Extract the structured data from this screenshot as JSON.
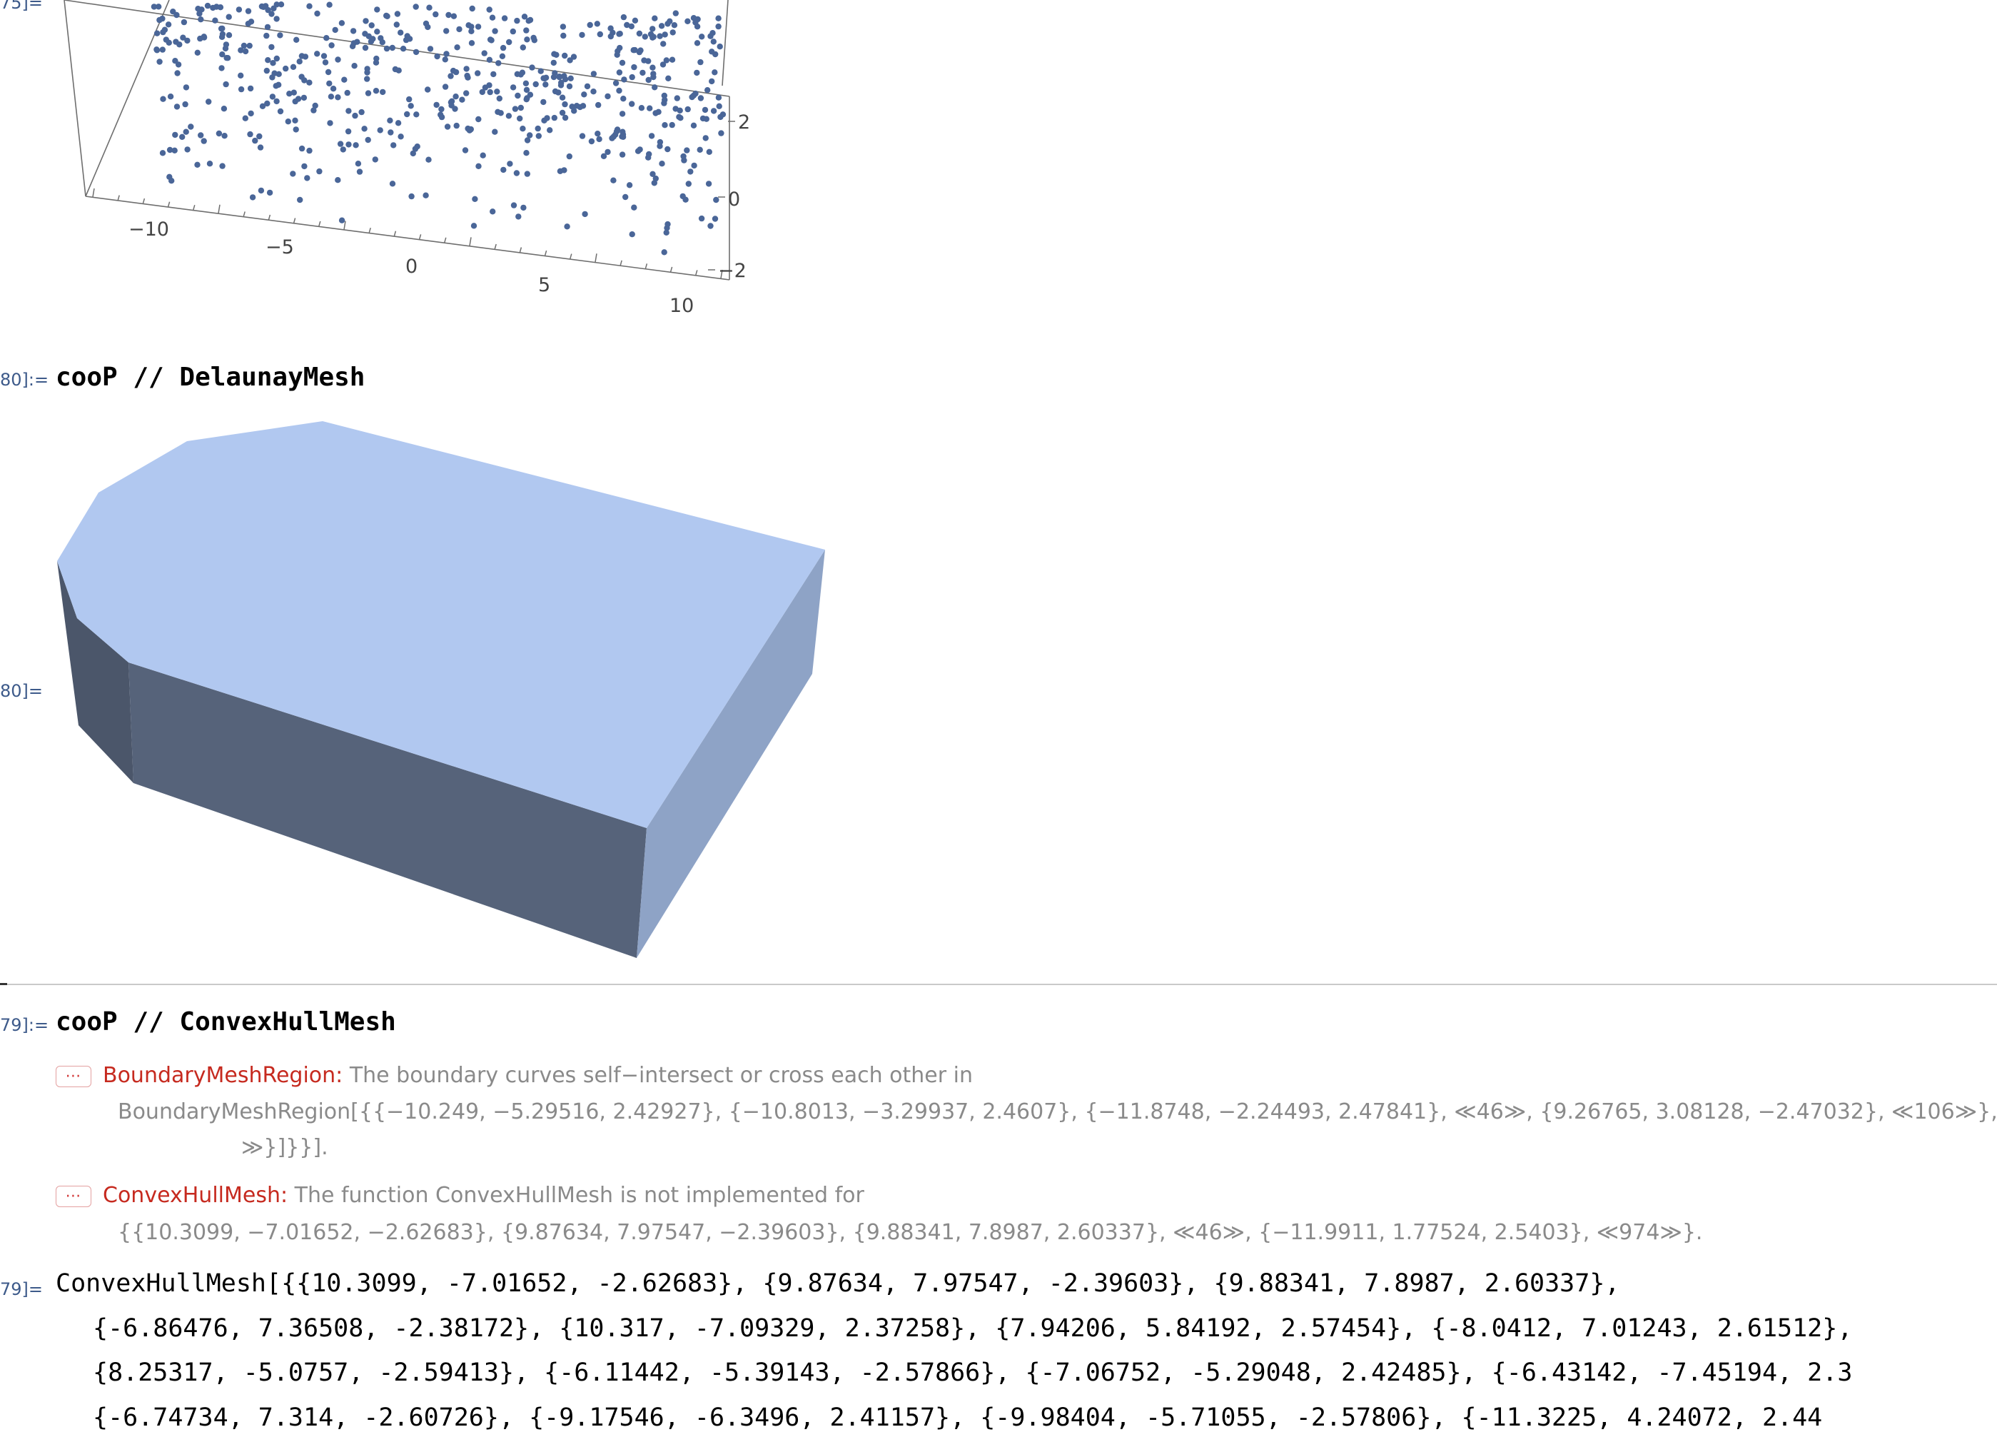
{
  "cells": {
    "out75_label": "75]=",
    "in80_label": "80]:=",
    "in80_code": "cooP // DelaunayMesh",
    "out80_label": "80]=",
    "in79_label": "79]:=",
    "in79_code": "cooP // ConvexHullMesh",
    "out79_label": "79]="
  },
  "scatter_plot": {
    "x_ticks": [
      "−10",
      "−5",
      "0",
      "5",
      "10"
    ],
    "z_ticks": [
      "2",
      "0",
      "−2"
    ],
    "point_color": "#4a6698"
  },
  "mesh": {
    "top_color": "#b1c8f0",
    "front_color": "#56637a",
    "right_color": "#8ea3c6",
    "left_color": "#4a5568"
  },
  "messages": [
    {
      "fn": "BoundaryMeshRegion",
      "colon": ":",
      "text": " The boundary curves self−intersect or cross each other in",
      "line2": "BoundaryMeshRegion[{{−10.249, −5.29516, 2.42927}, {−10.8013, −3.29937, 2.4607}, {−11.8748, −2.24493, 2.47841}, ≪46≫, {9.26765, 3.08128, −2.47032}, ≪106≫}, {",
      "line3": "≫}]}}]."
    },
    {
      "fn": "ConvexHullMesh",
      "colon": ":",
      "text": " The function ConvexHullMesh is not implemented for",
      "line2": "{{10.3099, −7.01652, −2.62683}, {9.87634, 7.97547, −2.39603}, {9.88341, 7.8987, 2.60337}, ≪46≫, {−11.9911, 1.77524, 2.5403}, ≪974≫}."
    }
  ],
  "output_lines": [
    "ConvexHullMesh[{{10.3099, -7.01652, -2.62683}, {9.87634, 7.97547, -2.39603}, {9.88341, 7.8987, 2.60337},",
    "{-6.86476, 7.36508, -2.38172}, {10.317, -7.09329, 2.37258}, {7.94206, 5.84192, 2.57454}, {-8.0412, 7.01243, 2.61512},",
    "{8.25317, -5.0757, -2.59413}, {-6.11442, -5.39143, -2.57866}, {-7.06752, -5.29048, 2.42485}, {-6.43142, -7.45194, 2.3",
    "{-6.74734, 7.314, -2.60726}, {-9.17546, -6.3496, 2.41157}, {-9.98404, -5.71055, -2.57806}, {-11.3225, 4.24072, 2.44"
  ]
}
